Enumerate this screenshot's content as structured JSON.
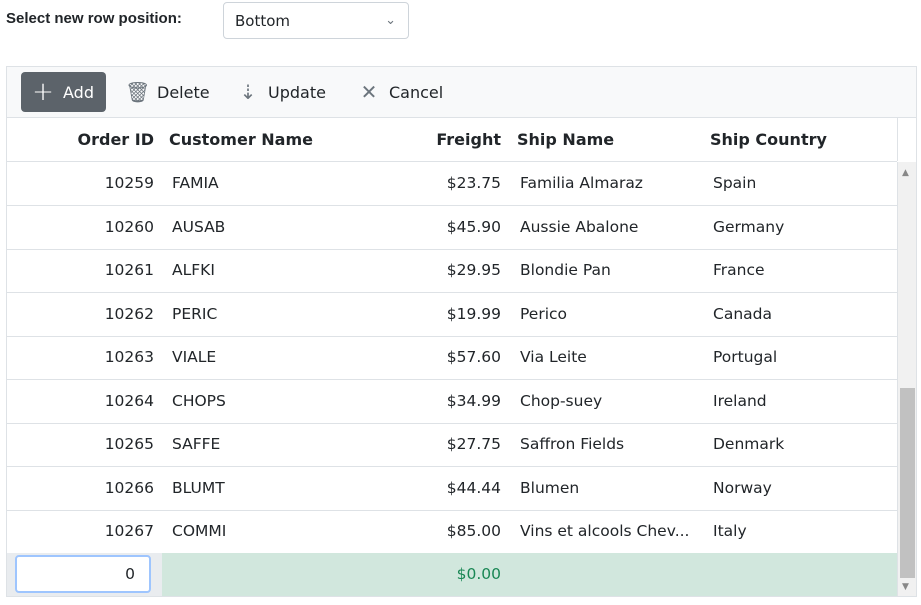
{
  "position": {
    "label": "Select new row position:",
    "selected": "Bottom"
  },
  "toolbar": {
    "add": "Add",
    "delete": "Delete",
    "update": "Update",
    "cancel": "Cancel"
  },
  "columns": [
    "Order ID",
    "Customer Name",
    "Freight",
    "Ship Name",
    "Ship Country"
  ],
  "rows": [
    [
      "10259",
      "FAMIA",
      "$23.75",
      "Familia Almaraz",
      "Spain"
    ],
    [
      "10260",
      "AUSAB",
      "$45.90",
      "Aussie Abalone",
      "Germany"
    ],
    [
      "10261",
      "ALFKI",
      "$29.95",
      "Blondie Pan",
      "France"
    ],
    [
      "10262",
      "PERIC",
      "$19.99",
      "Perico",
      "Canada"
    ],
    [
      "10263",
      "VIALE",
      "$57.60",
      "Via Leite",
      "Portugal"
    ],
    [
      "10264",
      "CHOPS",
      "$34.99",
      "Chop-suey",
      "Ireland"
    ],
    [
      "10265",
      "SAFFE",
      "$27.75",
      "Saffron Fields",
      "Denmark"
    ],
    [
      "10266",
      "BLUMT",
      "$44.44",
      "Blumen",
      "Norway"
    ],
    [
      "10267",
      "COMMI",
      "$85.00",
      "Vins et alcools Chev...",
      "Italy"
    ]
  ],
  "new_row": {
    "order_id": "0",
    "freight": "$0.00"
  },
  "colors": {
    "add_button": "#5c636a",
    "new_row_bg": "#d1e7dd",
    "freight_new": "#198754"
  }
}
